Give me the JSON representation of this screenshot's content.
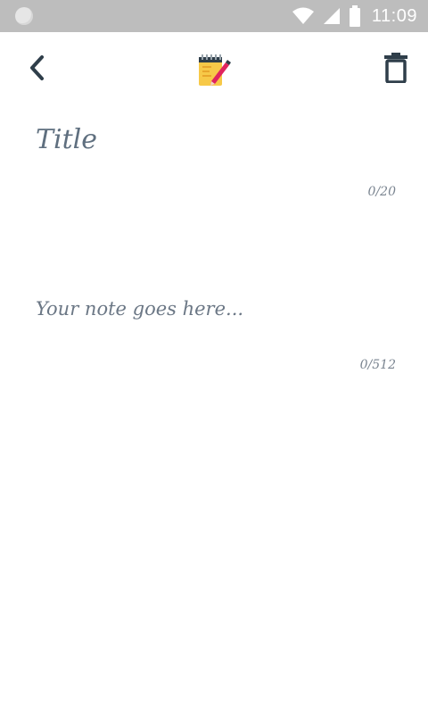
{
  "status_bar": {
    "time": "11:09",
    "icons": [
      "notification-dot-icon",
      "wifi-icon",
      "signal-icon",
      "battery-icon"
    ],
    "background": "#bdbdbd"
  },
  "app_bar": {
    "back_icon": "chevron-left-icon",
    "logo_icon": "notepad-pen-icon",
    "delete_icon": "trash-icon"
  },
  "editor": {
    "title_placeholder": "Title",
    "title_value": "",
    "title_counter": "0/20",
    "note_placeholder": "Your note goes here...",
    "note_value": "",
    "note_counter": "0/512"
  },
  "colors": {
    "icon_dark": "#2f3e4a",
    "text_gray": "#5f6f7f",
    "notepad_yellow": "#f7c948",
    "pen_red": "#e0245e"
  }
}
